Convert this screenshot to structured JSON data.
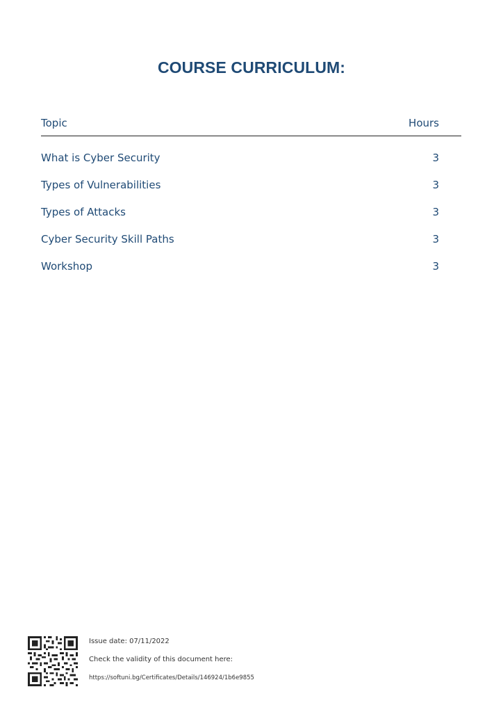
{
  "title": "COURSE CURRICULUM:",
  "table": {
    "header": {
      "topic": "Topic",
      "hours": "Hours"
    },
    "rows": [
      {
        "topic": "What is Cyber Security",
        "hours": "3"
      },
      {
        "topic": "Types of Vulnerabilities",
        "hours": "3"
      },
      {
        "topic": "Types of Attacks",
        "hours": "3"
      },
      {
        "topic": "Cyber Security Skill Paths",
        "hours": "3"
      },
      {
        "topic": "Workshop",
        "hours": "3"
      }
    ]
  },
  "footer": {
    "issue_date": "Issue date: 07/11/2022",
    "check_text": "Check the validity of this document here:",
    "url": "https://softuni.bg/Certificates/Details/146924/1b6e9855",
    "qr_icon": "qr-code-icon"
  },
  "colors": {
    "accent": "#1f4a75",
    "text_muted": "#333333",
    "rule": "#222222"
  }
}
